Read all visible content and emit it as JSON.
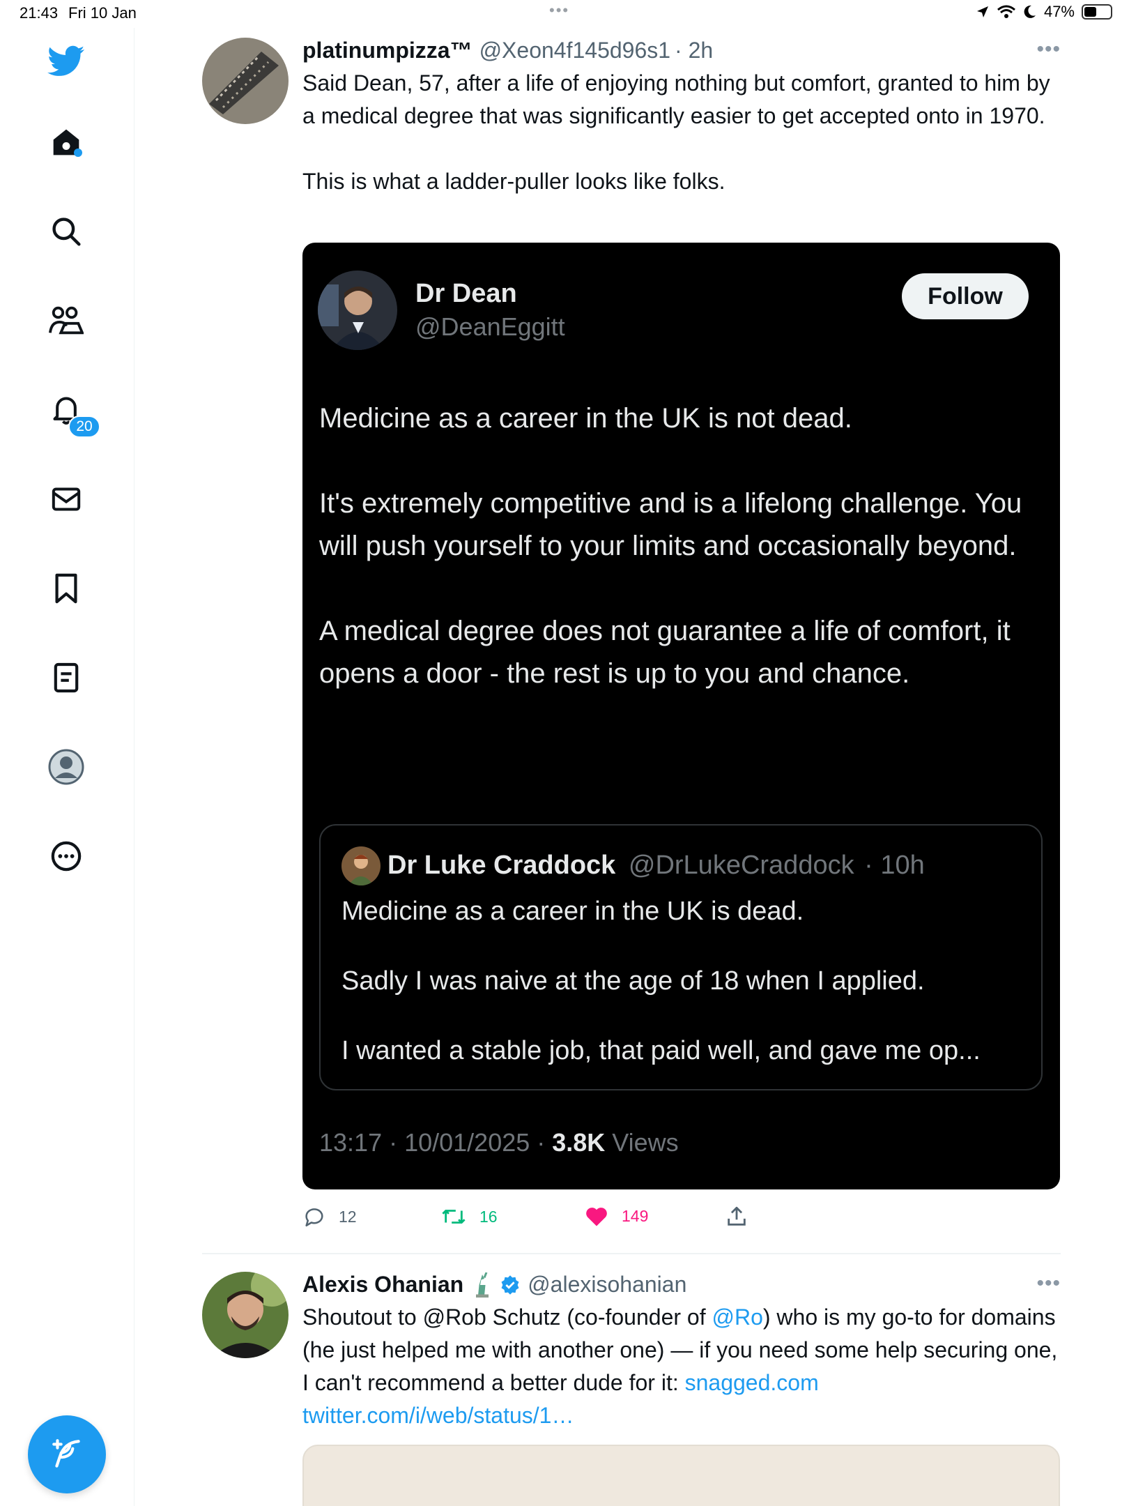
{
  "status_bar": {
    "time": "21:43",
    "date": "Fri 10 Jan",
    "battery": "47%",
    "battery_level": 0.47
  },
  "sidebar": {
    "items": [
      {
        "icon": "twitter-bird-icon"
      },
      {
        "icon": "home-icon"
      },
      {
        "icon": "search-icon"
      },
      {
        "icon": "communities-icon"
      },
      {
        "icon": "notifications-icon",
        "badge": "20"
      },
      {
        "icon": "messages-icon"
      },
      {
        "icon": "bookmarks-icon"
      },
      {
        "icon": "lists-icon"
      },
      {
        "icon": "profile-icon"
      },
      {
        "icon": "more-icon"
      }
    ],
    "compose_icon": "compose-icon"
  },
  "tweets": [
    {
      "name": "platinumpizza™",
      "handle": "@Xeon4f145d96s1",
      "time": "· 2h",
      "text": "Said Dean, 57, after a life of enjoying nothing but comfort, granted to him by a medical degree that was significantly easier to get accepted onto in 1970.\n\nThis is what a ladder-puller looks like folks.",
      "embed": {
        "name": "Dr Dean",
        "handle": "@DeanEggitt",
        "follow_label": "Follow",
        "body": "Medicine as a career in the UK is not dead.\n\nIt's extremely competitive and is a lifelong challenge. You will push yourself to your limits and occasionally beyond.\n\nA medical degree does not guarantee a life of comfort, it opens a door - the rest is up to you and chance.",
        "quote": {
          "name": "Dr Luke Craddock",
          "handle": "@DrLukeCraddock",
          "time": "· 10h",
          "body": "Medicine as a career in the UK is dead.\n\nSadly I was naive at the age of 18 when I applied.\n\nI wanted a stable job, that paid well, and gave me op..."
        },
        "meta_time": "13:17 · 10/01/2025 · ",
        "views_count": "3.8K",
        "views_label": " Views"
      },
      "actions": {
        "replies": "12",
        "retweets": "16",
        "likes": "149"
      }
    },
    {
      "name": "Alexis Ohanian",
      "handle": "@alexisohanian",
      "text_part1": "Shoutout to @Rob Schutz (co-founder of ",
      "mention": "@Ro",
      "text_part2": ") who is my go-to for domains (he just helped me with another one) — if you need some help securing one, I can't recommend a better dude for it: ",
      "link1": "snagged.com",
      "link2": "twitter.com/i/web/status/1…"
    }
  ],
  "colors": {
    "accent": "#1d9bf0",
    "retweet": "#00ba7c",
    "like": "#f91880",
    "text": "#0f1419",
    "muted": "#536471"
  }
}
